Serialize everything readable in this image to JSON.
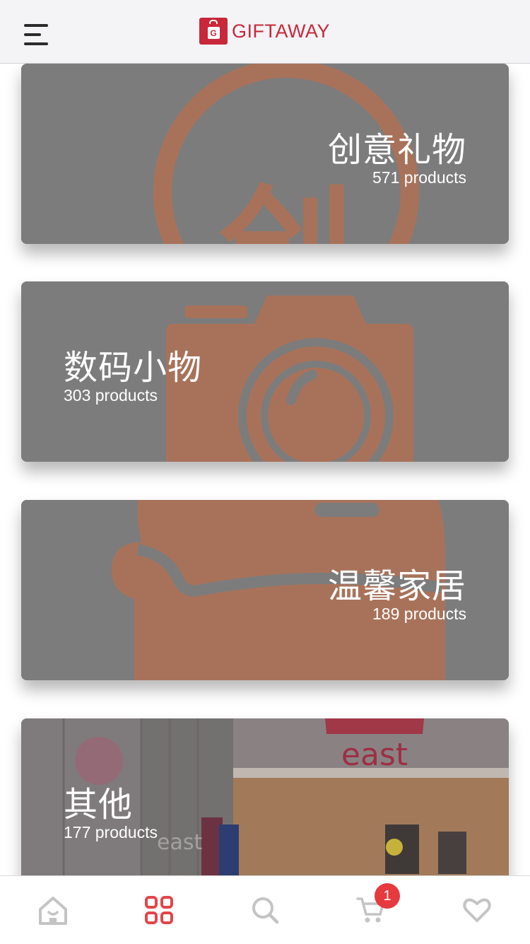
{
  "header": {
    "logo_letter": "G",
    "logo_text": "GIFTAWAY"
  },
  "categories": [
    {
      "title": "创意礼物",
      "count": "571 products",
      "icon": "creative-gift-icon"
    },
    {
      "title": "数码小物",
      "count": "303 products",
      "icon": "camera-icon"
    },
    {
      "title": "温馨家居",
      "count": "189 products",
      "icon": "sofa-icon"
    },
    {
      "title": "其他",
      "count": "177 products",
      "icon": "storefront-photo"
    }
  ],
  "decor": {
    "creative_glyph": "创",
    "store_sign": "east"
  },
  "bottom_nav": {
    "items": [
      "home-icon",
      "categories-icon",
      "search-icon",
      "cart-icon",
      "favorites-icon"
    ],
    "cart_badge": "1",
    "active": "categories-icon"
  },
  "colors": {
    "brand": "#c9273a",
    "active_nav": "#e0474a",
    "inactive_nav": "#c4c4c4",
    "badge": "#e63a3e",
    "card_overlay": "#7c7c7c",
    "card_icon": "#a8725a"
  }
}
